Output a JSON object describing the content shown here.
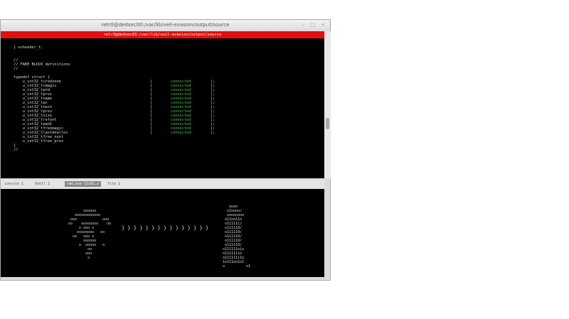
{
  "window": {
    "title": "retr0@dedsec00:/var/lib/veil-evasion/output/source",
    "controls": "– □ ×"
  },
  "terminal": {
    "title": "retr0@dedsec03:/var/lib/veil-evasion/output/source",
    "header_lines": [
      "} nvheader_t;",
      "",
      "",
      "//",
      "// FAKE BLOCK definitions",
      "//",
      "",
      "typedef struct {"
    ],
    "fields": [
      {
        "name": "u_int32_tcredzone",
        "status": "connected"
      },
      {
        "name": "u_int32_tcmagic",
        "status": "connected"
      },
      {
        "name": "u_int32_tptd",
        "status": "connected"
      },
      {
        "name": "u_int32_tproc",
        "status": "connected"
      },
      {
        "name": "u_int32_tname",
        "status": "connected"
      },
      {
        "name": "u_int32_tpc",
        "status": "connected"
      },
      {
        "name": "u_int32_tnext",
        "status": "connected"
      },
      {
        "name": "u_int32_tprev",
        "status": "connected"
      },
      {
        "name": "u_int32_tsize",
        "status": "connected"
      },
      {
        "name": "u_int32_trefont",
        "status": "connected"
      },
      {
        "name": "u_int32_tpad1",
        "status": "connected"
      },
      {
        "name": "u_int32_tfreemagic",
        "status": "connected"
      },
      {
        "name": "u_int32_tlastdealloc",
        "status": "connected"
      },
      {
        "name": "u_int32_tfree_next",
        "status": ""
      },
      {
        "name": "u_int32_tfree_prev",
        "status": ""
      }
    ],
    "footer_lines": [
      "}",
      "//"
    ]
  },
  "tabs": [
    {
      "label": "console 1"
    },
    {
      "label": "Shell 2"
    },
    {
      "label": "cmd.exe 52x81.x"
    },
    {
      "label": "file 1"
    }
  ],
  "art": {
    "left": "        oooooo\n    oooooooooooo\n  ooo            ooo\n oo    oooooooo    oo\n      o ooo o\n     oooooooo   oo\n   oo   ooo o\n        oooooo\n      o  ooooo   o\n          oo\n         ooo\n          o",
    "arrows": "} } } } } } } } } } } } } } }",
    "right": "   oooo\n  o1oooo/\n  oooooooo\n o11oo11o\n o111111/\n o111110/\n o111110/\n o111110/\n o111110/\n o111110/\no111111o}o\no1111111o\no11111111o\n1o111oo1o1\no          o1"
  }
}
